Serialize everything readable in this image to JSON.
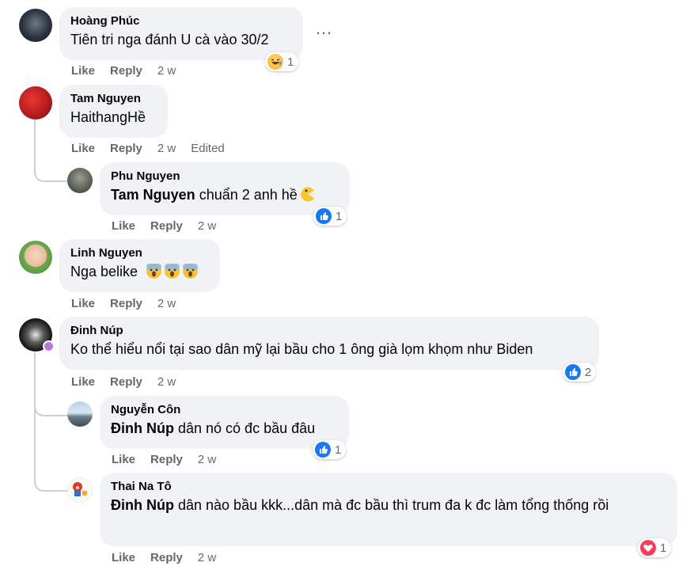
{
  "comments": [
    {
      "author": "Hoàng Phúc",
      "text": "Tiên tri nga đánh U cà vào 30/2",
      "like": "Like",
      "reply": "Reply",
      "time": "2 w",
      "reaction_count": "1",
      "reaction": "haha"
    },
    {
      "author": "Tam Nguyen",
      "text": "HaithangHề",
      "like": "Like",
      "reply": "Reply",
      "time": "2 w",
      "edited": "Edited"
    },
    {
      "author": "Phu Nguyen",
      "mention": "Tam Nguyen",
      "text": " chuẩn 2 anh hề",
      "like": "Like",
      "reply": "Reply",
      "time": "2 w",
      "reaction_count": "1",
      "reaction": "like"
    },
    {
      "author": "Linh Nguyen",
      "text": "Nga belike",
      "like": "Like",
      "reply": "Reply",
      "time": "2 w"
    },
    {
      "author": "Đinh Núp",
      "text": "Ko thể hiểu nổi tại sao dân mỹ lại bầu cho 1 ông già lọm khọm như Biden",
      "like": "Like",
      "reply": "Reply",
      "time": "2 w",
      "reaction_count": "2",
      "reaction": "like"
    },
    {
      "author": "Nguyễn Côn",
      "mention": "Đinh Núp",
      "text": " dân nó có đc bầu đâu",
      "like": "Like",
      "reply": "Reply",
      "time": "2 w",
      "reaction_count": "1",
      "reaction": "like"
    },
    {
      "author": "Thai Na Tô",
      "mention": "Đinh Núp",
      "text": " dân nào bầu kkk...dân mà đc bầu thì trum đa k đc làm tổng thống rồi",
      "like": "Like",
      "reply": "Reply",
      "time": "2 w",
      "reaction_count": "1",
      "reaction": "love"
    }
  ],
  "more_icon": "…",
  "colors": {
    "bubble": "#f0f2f5",
    "meta": "#65676b",
    "like_blue": "#1877f2",
    "love_red": "#f33e58",
    "thread": "#ced0d4"
  }
}
